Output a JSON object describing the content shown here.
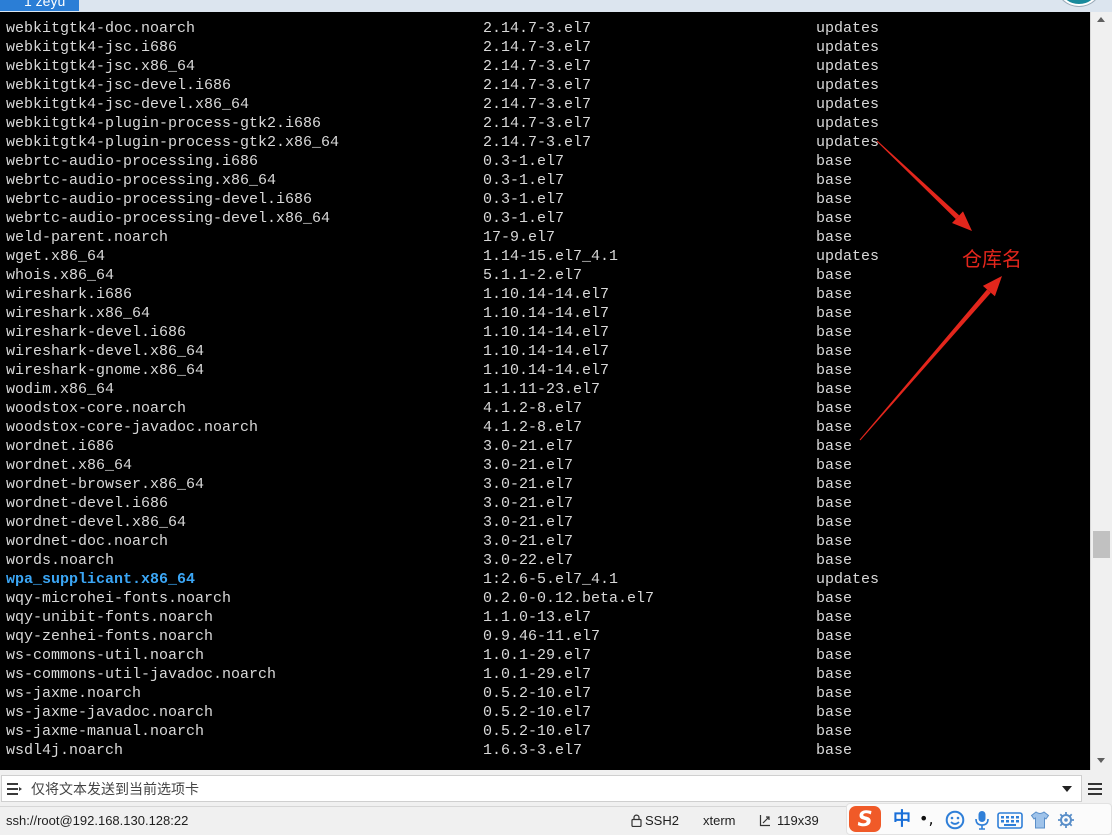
{
  "window": {
    "tab": {
      "label": "1 zeyu"
    },
    "corner_icon": "status-orb-icon"
  },
  "terminal": {
    "scroll_fraction": 0.72,
    "lines": [
      {
        "name": "webkitgtk4-doc.noarch",
        "version": "2.14.7-3.el7",
        "repo": "updates"
      },
      {
        "name": "webkitgtk4-jsc.i686",
        "version": "2.14.7-3.el7",
        "repo": "updates"
      },
      {
        "name": "webkitgtk4-jsc.x86_64",
        "version": "2.14.7-3.el7",
        "repo": "updates"
      },
      {
        "name": "webkitgtk4-jsc-devel.i686",
        "version": "2.14.7-3.el7",
        "repo": "updates"
      },
      {
        "name": "webkitgtk4-jsc-devel.x86_64",
        "version": "2.14.7-3.el7",
        "repo": "updates"
      },
      {
        "name": "webkitgtk4-plugin-process-gtk2.i686",
        "version": "2.14.7-3.el7",
        "repo": "updates"
      },
      {
        "name": "webkitgtk4-plugin-process-gtk2.x86_64",
        "version": "2.14.7-3.el7",
        "repo": "updates"
      },
      {
        "name": "webrtc-audio-processing.i686",
        "version": "0.3-1.el7",
        "repo": "base"
      },
      {
        "name": "webrtc-audio-processing.x86_64",
        "version": "0.3-1.el7",
        "repo": "base"
      },
      {
        "name": "webrtc-audio-processing-devel.i686",
        "version": "0.3-1.el7",
        "repo": "base"
      },
      {
        "name": "webrtc-audio-processing-devel.x86_64",
        "version": "0.3-1.el7",
        "repo": "base"
      },
      {
        "name": "weld-parent.noarch",
        "version": "17-9.el7",
        "repo": "base"
      },
      {
        "name": "wget.x86_64",
        "version": "1.14-15.el7_4.1",
        "repo": "updates"
      },
      {
        "name": "whois.x86_64",
        "version": "5.1.1-2.el7",
        "repo": "base"
      },
      {
        "name": "wireshark.i686",
        "version": "1.10.14-14.el7",
        "repo": "base"
      },
      {
        "name": "wireshark.x86_64",
        "version": "1.10.14-14.el7",
        "repo": "base"
      },
      {
        "name": "wireshark-devel.i686",
        "version": "1.10.14-14.el7",
        "repo": "base"
      },
      {
        "name": "wireshark-devel.x86_64",
        "version": "1.10.14-14.el7",
        "repo": "base"
      },
      {
        "name": "wireshark-gnome.x86_64",
        "version": "1.10.14-14.el7",
        "repo": "base"
      },
      {
        "name": "wodim.x86_64",
        "version": "1.1.11-23.el7",
        "repo": "base"
      },
      {
        "name": "woodstox-core.noarch",
        "version": "4.1.2-8.el7",
        "repo": "base"
      },
      {
        "name": "woodstox-core-javadoc.noarch",
        "version": "4.1.2-8.el7",
        "repo": "base"
      },
      {
        "name": "wordnet.i686",
        "version": "3.0-21.el7",
        "repo": "base"
      },
      {
        "name": "wordnet.x86_64",
        "version": "3.0-21.el7",
        "repo": "base"
      },
      {
        "name": "wordnet-browser.x86_64",
        "version": "3.0-21.el7",
        "repo": "base"
      },
      {
        "name": "wordnet-devel.i686",
        "version": "3.0-21.el7",
        "repo": "base"
      },
      {
        "name": "wordnet-devel.x86_64",
        "version": "3.0-21.el7",
        "repo": "base"
      },
      {
        "name": "wordnet-doc.noarch",
        "version": "3.0-21.el7",
        "repo": "base"
      },
      {
        "name": "words.noarch",
        "version": "3.0-22.el7",
        "repo": "base"
      },
      {
        "name": "wpa_supplicant.x86_64",
        "version": "1:2.6-5.el7_4.1",
        "repo": "updates",
        "highlight_color": "#3ba6f5"
      },
      {
        "name": "wqy-microhei-fonts.noarch",
        "version": "0.2.0-0.12.beta.el7",
        "repo": "base"
      },
      {
        "name": "wqy-unibit-fonts.noarch",
        "version": "1.1.0-13.el7",
        "repo": "base"
      },
      {
        "name": "wqy-zenhei-fonts.noarch",
        "version": "0.9.46-11.el7",
        "repo": "base"
      },
      {
        "name": "ws-commons-util.noarch",
        "version": "1.0.1-29.el7",
        "repo": "base"
      },
      {
        "name": "ws-commons-util-javadoc.noarch",
        "version": "1.0.1-29.el7",
        "repo": "base"
      },
      {
        "name": "ws-jaxme.noarch",
        "version": "0.5.2-10.el7",
        "repo": "base"
      },
      {
        "name": "ws-jaxme-javadoc.noarch",
        "version": "0.5.2-10.el7",
        "repo": "base"
      },
      {
        "name": "ws-jaxme-manual.noarch",
        "version": "0.5.2-10.el7",
        "repo": "base"
      },
      {
        "name": "wsdl4j.noarch",
        "version": "1.6.3-3.el7",
        "repo": "base"
      }
    ]
  },
  "annotation": {
    "label": "仓库名",
    "color": "#e3261c"
  },
  "compose_bar": {
    "placeholder": "仅将文本发送到当前选项卡",
    "menu_icon": "send-menu-icon",
    "dropdown_icon": "chevron-down-icon",
    "options_icon": "menu-icon"
  },
  "status_bar": {
    "connection": "ssh://root@192.168.130.128:22",
    "protocol_icon": "lock-icon",
    "protocol": "SSH2",
    "terminal_type": "xterm",
    "size_icon": "resize-icon",
    "size": "119x39"
  },
  "ime_toolbar": {
    "logo": "S",
    "mode_label": "中",
    "punctuation_label": "•,",
    "icons": [
      "smiley-icon",
      "microphone-icon",
      "keyboard-icon",
      "shirt-icon",
      "toolbox-icon"
    ]
  },
  "colors": {
    "terminal_background": "#000000",
    "terminal_text": "#d9d9d9",
    "tab_active": "#2b7ed6",
    "ime_accent": "#1a6fd8"
  }
}
